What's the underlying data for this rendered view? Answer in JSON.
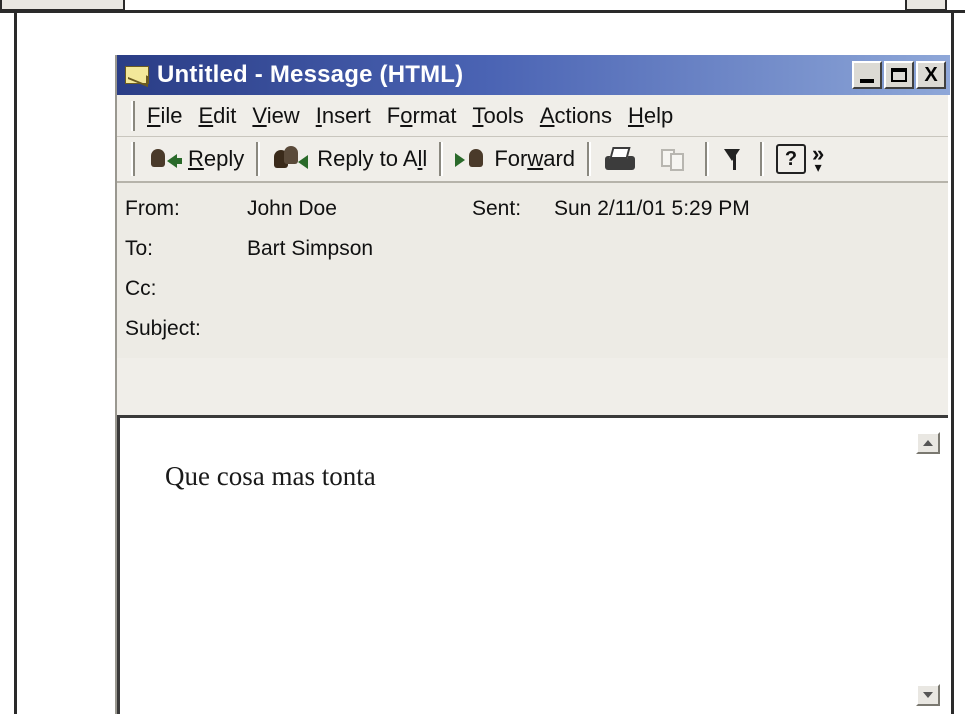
{
  "window": {
    "title": "Untitled - Message (HTML)",
    "buttons": {
      "minimize": "_",
      "maximize": "□",
      "close": "X"
    }
  },
  "menu": [
    {
      "pre": "",
      "u": "F",
      "post": "ile"
    },
    {
      "pre": "",
      "u": "E",
      "post": "dit"
    },
    {
      "pre": "",
      "u": "V",
      "post": "iew"
    },
    {
      "pre": "",
      "u": "I",
      "post": "nsert"
    },
    {
      "pre": "F",
      "u": "o",
      "post": "rmat"
    },
    {
      "pre": "",
      "u": "T",
      "post": "ools"
    },
    {
      "pre": "",
      "u": "A",
      "post": "ctions"
    },
    {
      "pre": "",
      "u": "H",
      "post": "elp"
    }
  ],
  "toolbar": {
    "reply": {
      "pre": "",
      "u": "R",
      "post": "eply"
    },
    "reply_all": {
      "pre": "Reply to A",
      "u": "l",
      "post": "l"
    },
    "forward": {
      "pre": "For",
      "u": "w",
      "post": "ard"
    },
    "help": "?",
    "more": "»",
    "icons": {
      "reply": "reply-icon",
      "reply_all": "reply-all-icon",
      "forward": "forward-icon",
      "print": "print-icon",
      "copy": "copy-icon",
      "flag": "flag-icon"
    }
  },
  "header": {
    "from_label": "From:",
    "from_value": "John Doe",
    "sent_label": "Sent:",
    "sent_value": "Sun 2/11/01 5:29 PM",
    "to_label": "To:",
    "to_value": "Bart Simpson",
    "cc_label": "Cc:",
    "subject_label": "Subject:"
  },
  "body": {
    "text": "Que cosa mas tonta"
  },
  "colors": {
    "titlebar_start": "#2a3d86",
    "titlebar_end": "#8ea7d8",
    "window_bg": "#f0eee9"
  }
}
